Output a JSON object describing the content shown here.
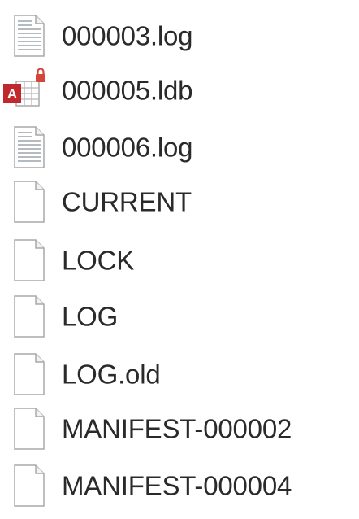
{
  "files": [
    {
      "name": "000003.log",
      "icon": "text-document-icon"
    },
    {
      "name": "000005.ldb",
      "icon": "access-database-locked-icon"
    },
    {
      "name": "000006.log",
      "icon": "text-document-icon"
    },
    {
      "name": "CURRENT",
      "icon": "blank-file-icon"
    },
    {
      "name": "LOCK",
      "icon": "blank-file-icon"
    },
    {
      "name": "LOG",
      "icon": "blank-file-icon"
    },
    {
      "name": "LOG.old",
      "icon": "blank-file-icon"
    },
    {
      "name": "MANIFEST-000002",
      "icon": "blank-file-icon"
    },
    {
      "name": "MANIFEST-000004",
      "icon": "blank-file-icon"
    }
  ],
  "colors": {
    "access_red": "#c0282d",
    "lock_red": "#d4453a",
    "page_border": "#a8a8a8",
    "text_lines": "#9aa3ab"
  }
}
